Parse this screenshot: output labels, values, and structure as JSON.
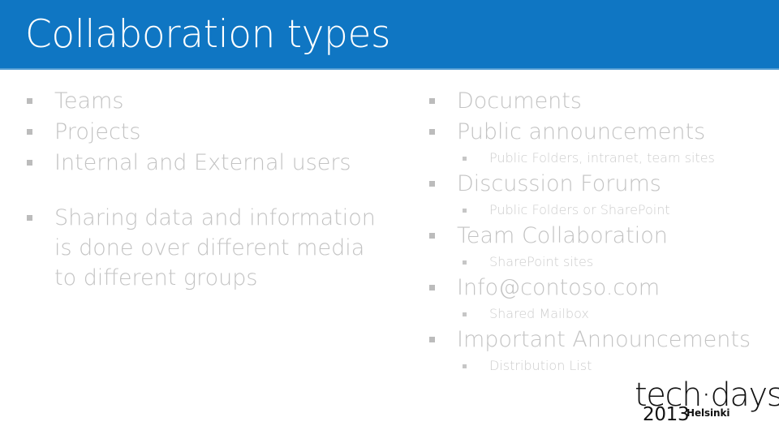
{
  "slide": {
    "title": "Collaboration types",
    "header_color": "#0f76c3",
    "title_color": "#ffffff",
    "body_text_color": "#c3c3c3",
    "bullet_color": "#bcbcbc",
    "background_color": "#ffffff"
  },
  "left_column": {
    "group_one": [
      {
        "level": 1,
        "text": "Teams"
      },
      {
        "level": 1,
        "text": "Projects"
      },
      {
        "level": 1,
        "text": "Internal and External users"
      }
    ],
    "group_two": [
      {
        "level": 1,
        "text": "Sharing data and information is done over different media to different groups"
      }
    ]
  },
  "right_column": {
    "items": [
      {
        "level": 1,
        "text": "Documents"
      },
      {
        "level": 1,
        "text": "Public announcements"
      },
      {
        "level": 2,
        "text": "Public Folders, intranet, team sites"
      },
      {
        "level": 1,
        "text": "Discussion Forums"
      },
      {
        "level": 2,
        "text": "Public Folders or SharePoint"
      },
      {
        "level": 1,
        "text": "Team Collaboration"
      },
      {
        "level": 2,
        "text": "SharePoint sites"
      },
      {
        "level": 1,
        "text": "Info@contoso.com"
      },
      {
        "level": 2,
        "text": "Shared Mailbox"
      },
      {
        "level": 1,
        "text": "Important Announcements"
      },
      {
        "level": 2,
        "text": "Distribution List"
      }
    ]
  },
  "logo": {
    "wordmark": "tech·days",
    "year": "2013",
    "city": "Helsinki"
  }
}
